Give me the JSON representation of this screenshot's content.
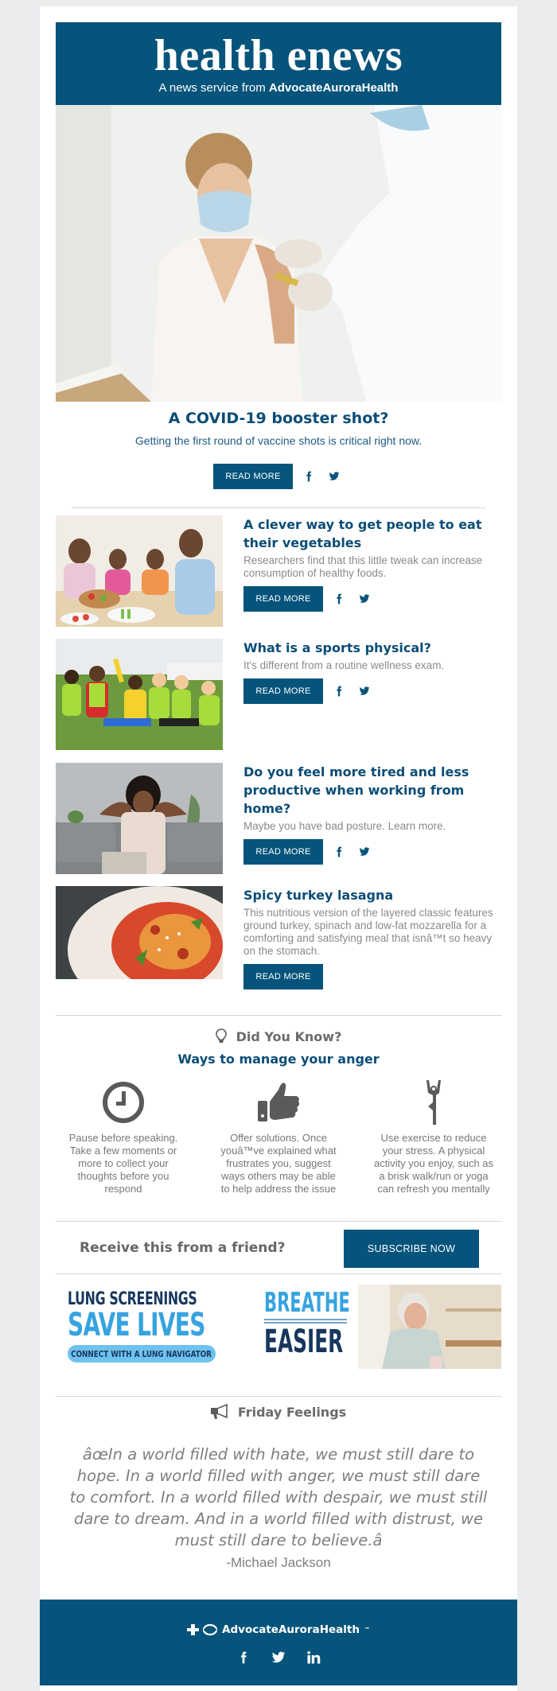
{
  "header": {
    "title": "health enews",
    "subtitle_prefix": "A news service from ",
    "subtitle_brand": "AdvocateAuroraHealth"
  },
  "hero": {
    "image_alt": "Woman receiving a vaccine shot from a masked health care worker",
    "title": "A COVID-19 booster shot?",
    "description": "Getting the first round of vaccine shots is critical right now.",
    "read_more": "READ MORE"
  },
  "articles": [
    {
      "image_alt": "Family eating a healthy meal with vegetables",
      "title": "A clever way to get people to eat their vegetables",
      "description": "Researchers find that this little tweak can increase consumption of healthy foods.",
      "read_more": "READ MORE",
      "share": true
    },
    {
      "image_alt": "Kids in sports jerseys cheering on a field",
      "title": "What is a sports physical?",
      "description": "It's different from a routine wellness exam.",
      "read_more": "READ MORE",
      "share": true
    },
    {
      "image_alt": "Woman stretching her neck while working on a laptop",
      "title": "Do you feel more tired and less productive when working from home?",
      "description": "Maybe you have bad posture. Learn more.",
      "read_more": "READ MORE",
      "share": true
    },
    {
      "image_alt": "Plate of spicy turkey lasagna",
      "title": "Spicy turkey lasagna",
      "description": "This nutritious version of the layered classic features ground turkey, spinach and low-fat mozzarella for a comforting and satisfying meal that isnâ™t so heavy on the stomach.",
      "read_more": "READ MORE",
      "share": false
    }
  ],
  "did_you_know": {
    "heading": "Did You Know?",
    "subheading": "Ways to manage your anger",
    "tips": [
      {
        "icon": "clock-icon",
        "text": "Pause before speaking. Take a few moments or more to collect your thoughts before you respond"
      },
      {
        "icon": "thumbs-up-icon",
        "text": "Offer solutions. Once youâ™ve explained what frustrates you, suggest ways others may be able to help address the issue"
      },
      {
        "icon": "yoga-pose-icon",
        "text": "Use exercise to reduce your stress. A physical activity you enjoy, such as a brisk walk/run or yoga can refresh you mentally"
      }
    ]
  },
  "subscribe": {
    "label": "Receive this from a friend?",
    "button": "SUBSCRIBE NOW"
  },
  "banner": {
    "line1": "LUNG SCREENINGS",
    "line2": "SAVE LIVES",
    "pill": "CONNECT WITH A LUNG NAVIGATOR",
    "breathe1": "BREATHE",
    "breathe2": "EASIER",
    "colors": {
      "navy": "#17375e",
      "sky": "#37a3e0",
      "pill": "#6fc1ee"
    }
  },
  "friday": {
    "heading": "Friday Feelings",
    "quote": "âœIn a world filled with hate, we must still dare to hope. In a world filled with anger, we must still dare to comfort. In a world filled with despair, we must still dare to dream. And in a world filled with distrust, we must still dare to believe.â",
    "author": "-Michael Jackson"
  },
  "footer": {
    "brand": "AdvocateAuroraHealth",
    "trademark": "™",
    "social": [
      "facebook",
      "twitter",
      "linkedin"
    ]
  },
  "colors": {
    "brand_blue": "#06547b",
    "title_blue": "#0b4d77",
    "page_bg": "#ebecee",
    "muted_text": "#8a8a8a"
  }
}
